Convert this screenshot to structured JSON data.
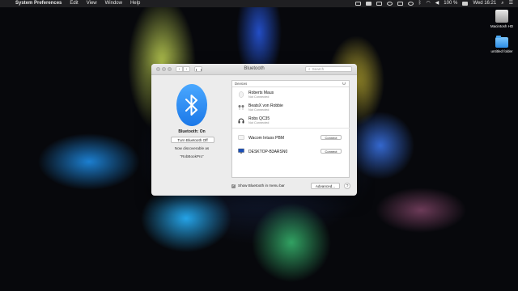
{
  "menubar": {
    "apple": "",
    "app": "System Preferences",
    "items": [
      "Edit",
      "View",
      "Window",
      "Help"
    ],
    "battery": "100 %",
    "clock": "Wed 16:21"
  },
  "desktop": {
    "icons": [
      {
        "label": "Macintosh HD",
        "icon": "hard-drive-icon"
      },
      {
        "label": "untitled folder",
        "icon": "folder-icon"
      }
    ]
  },
  "window": {
    "title": "Bluetooth",
    "search_placeholder": "Search",
    "left_pane": {
      "status": "Bluetooth: On",
      "toggle_button": "Turn Bluetooth Off",
      "discoverable_text": "Now discoverable as",
      "device_name": "“RobBookPro”"
    },
    "devices": {
      "header": "Devices",
      "items": [
        {
          "name": "Roberts Maus",
          "status": "Not Connected",
          "icon": "mouse-icon"
        },
        {
          "name": "BeatsX von Robbie",
          "status": "Not Connected",
          "icon": "earphones-icon"
        },
        {
          "name": "Robs QC35",
          "status": "Not Connected",
          "icon": "headphones-icon"
        },
        {
          "name": "Wacom Intuos PBM",
          "button": "Connect",
          "icon": "tablet-icon"
        },
        {
          "name": "DESKTOP-B3ARSN0",
          "button": "Connect",
          "icon": "computer-icon"
        }
      ]
    },
    "footer": {
      "show_in_menu_bar": "Show Bluetooth in menu bar",
      "advanced_button": "Advanced...",
      "help_button": "?"
    }
  },
  "colors": {
    "accent": "#1b78e8",
    "window_bg": "#ececec",
    "menubar_bg": "#1f1f22"
  }
}
